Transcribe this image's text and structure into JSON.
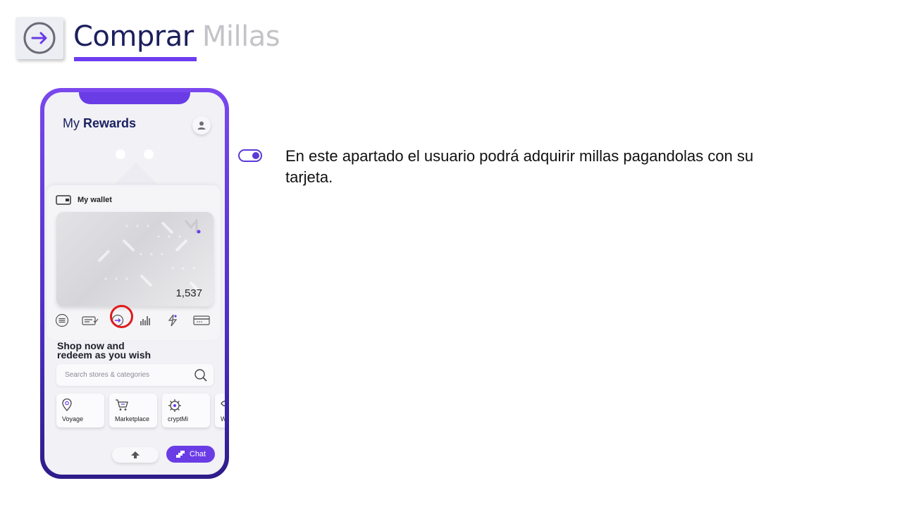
{
  "header": {
    "title_primary": "Comprar",
    "title_secondary": "Millas",
    "icon": "arrow-right-circle-icon",
    "accent_color": "#6c3cf0"
  },
  "content": {
    "bullet_icon": "toggle-icon",
    "description": "En este apartado el usuario podrá adquirir millas pagandolas con su tarjeta."
  },
  "phone": {
    "app_title_light": "My",
    "app_title_bold": "Rewards",
    "wallet_label": "My wallet",
    "card_balance": "1,537",
    "actions": [
      "menu-icon",
      "card-check-icon",
      "arrow-right-circle-icon",
      "chart-bars-icon",
      "transfer-icon",
      "credit-card-icon"
    ],
    "highlighted_action": "arrow-right-circle-icon",
    "shop_title_line1": "Shop now and",
    "shop_title_line2": "redeem as you wish",
    "search_placeholder": "Search stores & categories",
    "categories": [
      {
        "label": "Voyage",
        "icon": "location-pin-icon"
      },
      {
        "label": "Marketplace",
        "icon": "cart-icon"
      },
      {
        "label": "cryptMi",
        "icon": "gear-badge-icon"
      },
      {
        "label": "W",
        "icon": "eye-icon"
      }
    ],
    "chat_label": "Chat",
    "brand_color": "#6a3ce6"
  }
}
